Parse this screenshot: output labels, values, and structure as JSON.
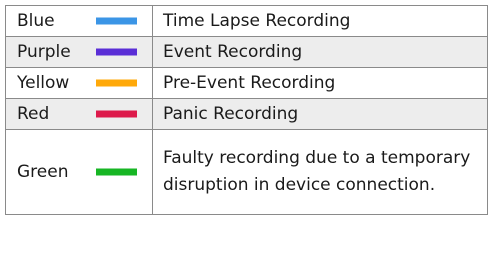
{
  "legend": {
    "rows": [
      {
        "color_name": "Blue",
        "swatch_color": "#3b95e6",
        "description": "Time Lapse Recording"
      },
      {
        "color_name": "Purple",
        "swatch_color": "#5a2ed6",
        "description": "Event Recording"
      },
      {
        "color_name": "Yellow",
        "swatch_color": "#ffa90a",
        "description": "Pre-Event Recording"
      },
      {
        "color_name": "Red",
        "swatch_color": "#dd1a4b",
        "description": "Panic Recording"
      },
      {
        "color_name": "Green",
        "swatch_color": "#17b624",
        "description": "Faulty recording due to a temporary disruption in device connection."
      }
    ]
  }
}
